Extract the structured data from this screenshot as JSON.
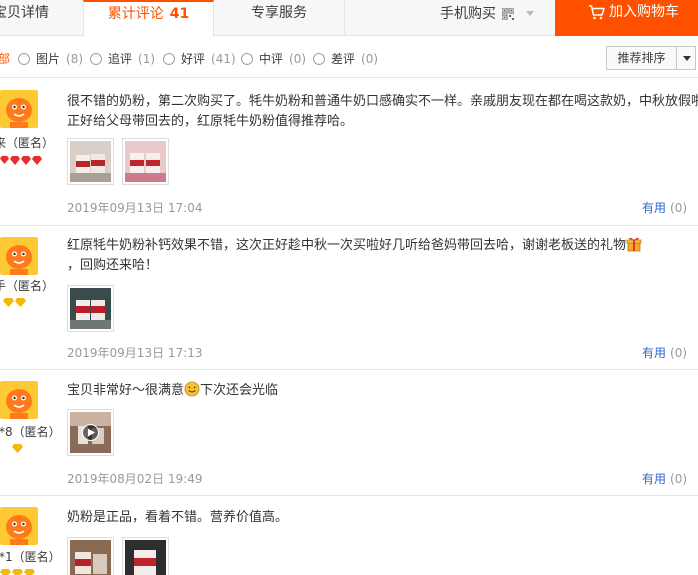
{
  "tabs": {
    "detail": "宝贝详情",
    "reviews_label": "累计评论",
    "reviews_count": "41",
    "service": "专享服务",
    "mobile_buy": "手机购买"
  },
  "cart_button": "加入购物车",
  "filters": {
    "all": "全部",
    "options": [
      {
        "label": "图片",
        "count": "(8)"
      },
      {
        "label": "追评",
        "count": "(1)"
      },
      {
        "label": "好评",
        "count": "(41)"
      },
      {
        "label": "中评",
        "count": "(0)"
      },
      {
        "label": "差评",
        "count": "(0)"
      }
    ],
    "sort": "推荐排序"
  },
  "reviews": [
    {
      "user": "来（匿名）",
      "badge_type": "red-diamond",
      "badge_count": 4,
      "text": "很不错的奶粉，第二次购买了。牦牛奶粉和普通牛奶口感确实不一样。亲戚朋友现在都在喝这款奶，中秋放假啦正好给父母带回去的，红原牦牛奶粉值得推荐哈。",
      "photos": 2,
      "date": "2019年09月13日 17:04",
      "useful_label": "有用",
      "useful_count": "(0)"
    },
    {
      "user": "手（匿名）",
      "badge_type": "yellow-diamond",
      "badge_count": 2,
      "text_a": "红原牦牛奶粉补钙效果不错，这次正好趁中秋一次买啦好几听给爸妈带回去哈，谢谢老板送的礼物",
      "text_b": "，回购还来哈！",
      "photos": 1,
      "date": "2019年09月13日 17:13",
      "useful_label": "有用",
      "useful_count": "(0)"
    },
    {
      "user": "*8（匿名）",
      "badge_type": "yellow-diamond",
      "badge_count": 1,
      "text_a": "宝贝非常好～很满意",
      "text_b": "下次还会光临",
      "photos": 1,
      "date": "2019年08月02日 19:49",
      "useful_label": "有用",
      "useful_count": "(0)"
    },
    {
      "user": "*1（匿名）",
      "badge_type": "yellow-diamond",
      "badge_count": 3,
      "text": "奶粉是正品，看着不错。营养价值高。",
      "photos": 2
    }
  ],
  "colors": {
    "accent": "#ff5000",
    "link": "#3366cc",
    "muted": "#999999"
  }
}
